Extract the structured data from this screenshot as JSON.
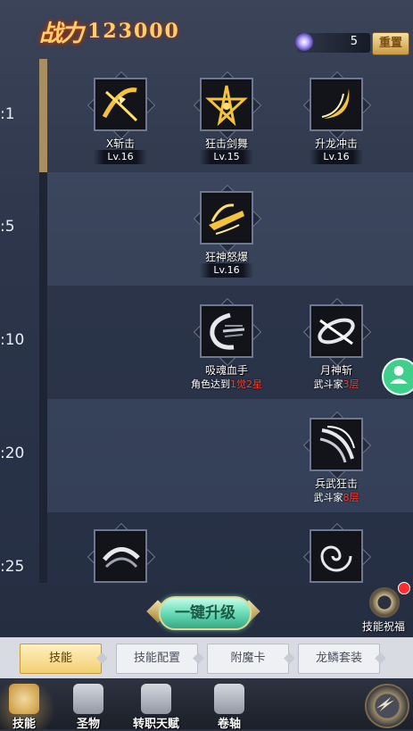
{
  "header": {
    "power_label": "战力",
    "power_value": "123000",
    "points": "5",
    "reset_label": "重置"
  },
  "levels": [
    ":1",
    ":5",
    ":10",
    ":20",
    ":25"
  ],
  "skills": {
    "x_slash": {
      "name": "X斩击",
      "level": "Lv.16"
    },
    "frenzy_dance": {
      "name": "狂击剑舞",
      "level": "Lv.15"
    },
    "dragon_strike": {
      "name": "升龙冲击",
      "level": "Lv.16"
    },
    "rage_burst": {
      "name": "狂神怒爆",
      "level": "Lv.16"
    },
    "soul_drain": {
      "name": "吸魂血手",
      "req_prefix": "角色达到",
      "req_value": "1觉2星"
    },
    "moon_slash": {
      "name": "月神斩",
      "req_prefix": "武斗家",
      "req_value": "3层"
    },
    "weapon_rage": {
      "name": "兵武狂击",
      "req_prefix": "武斗家",
      "req_value": "8层"
    }
  },
  "actions": {
    "upgrade_all": "一键升级",
    "skill_blessing": "技能祝福"
  },
  "tabs": [
    "技能",
    "技能配置",
    "附魔卡",
    "龙鳞套装"
  ],
  "nav": [
    "技能",
    "圣物",
    "转职天赋",
    "卷轴"
  ],
  "colors": {
    "accent_gold": "#ffcf6b",
    "req_red": "#ff3b30",
    "upgrade_green": "#6fe0bb"
  }
}
